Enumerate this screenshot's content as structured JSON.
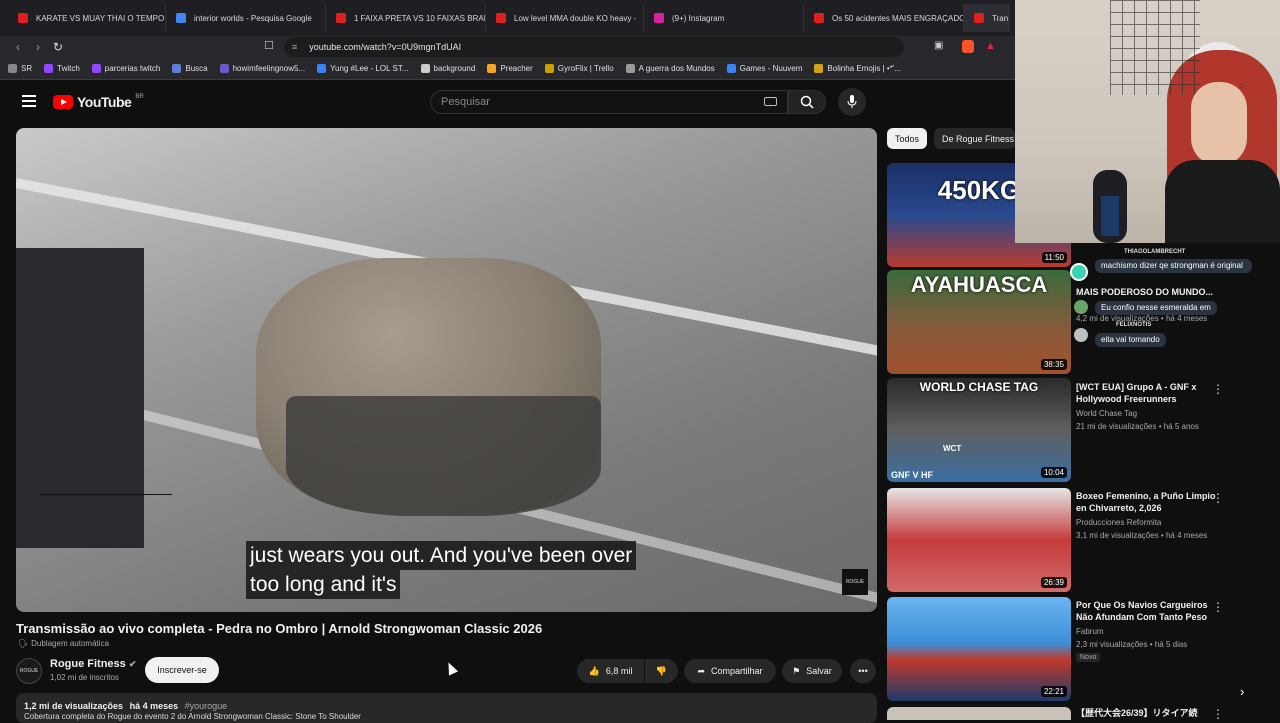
{
  "browser": {
    "tabs": [
      {
        "label": "KARATE VS MUAY THAI O TEMPO F",
        "color": "#e02020"
      },
      {
        "label": "interior worlds - Pesquisa Google",
        "color": "#4285f4"
      },
      {
        "label": "1 FAIXA PRETA VS 10 FAIXAS BRANC",
        "color": "#e02020"
      },
      {
        "label": "Low level MMA double KO heavy -",
        "color": "#e02020"
      },
      {
        "label": "(9+) Instagram",
        "color": "#d6249f"
      },
      {
        "label": "Os 50 acidentes MAIS ENGRAÇADO",
        "color": "#e02020"
      },
      {
        "label": "Tran",
        "color": "#e02020"
      }
    ],
    "url": "youtube.com/watch?v=0U9mgnTdUAI",
    "bookmarks": [
      {
        "label": "SR",
        "color": "#888"
      },
      {
        "label": "Twitch",
        "color": "#9146ff"
      },
      {
        "label": "parcerias twitch",
        "color": "#9146ff"
      },
      {
        "label": "Busca",
        "color": "#5b7fd6"
      },
      {
        "label": "howimfeelingnow5...",
        "color": "#6a5acd"
      },
      {
        "label": "Yung #Lee - LOL ST...",
        "color": "#3b82f6"
      },
      {
        "label": "background",
        "color": "#cccccc"
      },
      {
        "label": "Preacher",
        "color": "#f5a623"
      },
      {
        "label": "GyroFlix | Trello",
        "color": "#c8a000"
      },
      {
        "label": "A guerra dos Mundos",
        "color": "#999999"
      },
      {
        "label": "Games - Nuuvem",
        "color": "#3b82f6"
      },
      {
        "label": "Bolinha Emojis | •*'...",
        "color": "#d4a017"
      }
    ]
  },
  "youtube": {
    "logo": "YouTube",
    "country": "BR",
    "search_placeholder": "Pesquisar"
  },
  "video": {
    "caption_line1": "just wears you out. And you've been over",
    "caption_line2": "too long and it's",
    "watermark": "ROGUE",
    "title": "Transmissão ao vivo completa - Pedra no Ombro | Arnold Strongwoman Classic 2026",
    "dubbing": "Dublagem automática",
    "channel": "Rogue Fitness",
    "channel_avatar": "ROGUE",
    "subscribers": "1,02 mi de inscritos",
    "subscribe_label": "Inscrever-se",
    "likes": "6,8 mil",
    "share_label": "Compartilhar",
    "save_label": "Salvar",
    "views": "1,2 mi de visualizações",
    "age": "há 4 meses",
    "hashtag": "#yourogue",
    "description": "Cobertura completa do Rogue do evento 2 do Arnold Strongwoman Classic: Stone To Shoulder"
  },
  "chips": {
    "all": "Todos",
    "from_channel": "De Rogue Fitness"
  },
  "sidebar": [
    {
      "thumb_text": "450KG",
      "duration": "11:50",
      "title": "",
      "channel": "",
      "meta": "",
      "badge": ""
    },
    {
      "thumb_text": "AYAHUASCA",
      "duration": "38:35",
      "title": "MAIS PODEROSO DO MUNDO...",
      "channel": "",
      "meta": "4,2 mi de visualizações • há 4 meses",
      "badge": ""
    },
    {
      "thumb_text": "WORLD CHASE TAG",
      "duration": "10:04",
      "title": "[WCT EUA] Grupo A - GNF x Hollywood Freerunners",
      "channel": "World Chase Tag",
      "meta": "21 mi de visualizações • há 5 anos",
      "badge": ""
    },
    {
      "thumb_text": "",
      "duration": "26:39",
      "title": "Boxeo Femenino, a Puño Limpio en Chivarreto, 2,026",
      "channel": "Producciones Reformita",
      "meta": "3,1 mi de visualizações • há 4 meses",
      "badge": ""
    },
    {
      "thumb_text": "",
      "duration": "22:21",
      "title": "Por Que Os Navios Cargueiros Não Afundam Com Tanto Peso",
      "channel": "Fabrum",
      "meta": "2,3 mi visualizações • há 5 dias",
      "badge": "Novo"
    },
    {
      "thumb_text": "",
      "duration": "",
      "title": "【歴代大会26/39】リタイア続",
      "channel": "",
      "meta": "",
      "badge": ""
    }
  ],
  "sidebar_thumb_extra": {
    "gnf_label": "GNF V HF",
    "wct_label": "WCT"
  },
  "chat": [
    {
      "user": "THIAGOLAMBRECHT",
      "message": "machismo dizer qe strongman é original"
    },
    {
      "user": "",
      "message": "Eu confio nesse esmeralda em"
    },
    {
      "user": "FELIXNOTIS",
      "message": "eita vai tomando"
    }
  ]
}
